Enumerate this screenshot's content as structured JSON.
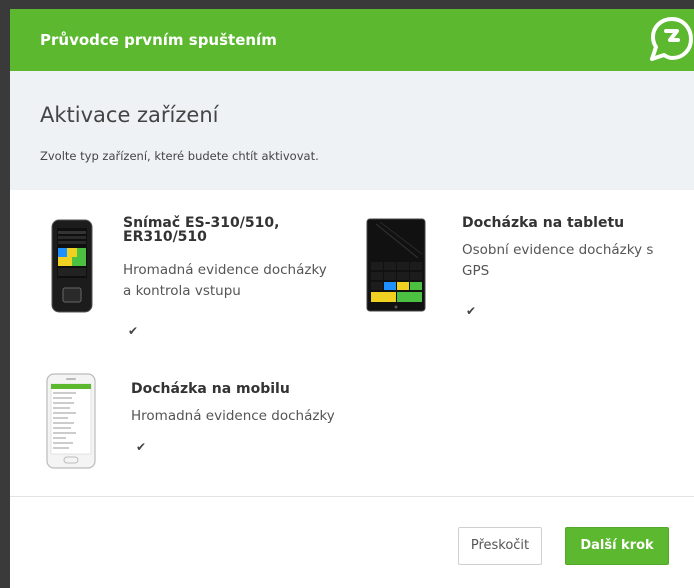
{
  "header": {
    "title": "Průvodce prvním spuštením",
    "logo_icon": "app-logo-icon"
  },
  "intro": {
    "title": "Aktivace zařízení",
    "subtitle": "Zvolte typ zařízení, které budete chtít aktivovat."
  },
  "devices": [
    {
      "title_line1": "Snímač ES-310/510,",
      "title_line2": "ER310/510",
      "desc_line1": "Hromadná evidence docházky",
      "desc_line2": "a kontrola vstupu",
      "checked": true
    },
    {
      "title_line1": "Docházka na tabletu",
      "desc_line1": "Osobní evidence docházky s",
      "desc_line2": "GPS",
      "checked": true
    },
    {
      "title_line1": "Docházka na mobilu",
      "desc_line1": "Hromadná evidence docházky",
      "checked": true
    }
  ],
  "footer": {
    "skip_label": "Přeskočit",
    "next_label": "Další krok"
  },
  "colors": {
    "accent": "#5cb82f",
    "intro_bg": "#eef2f5"
  }
}
